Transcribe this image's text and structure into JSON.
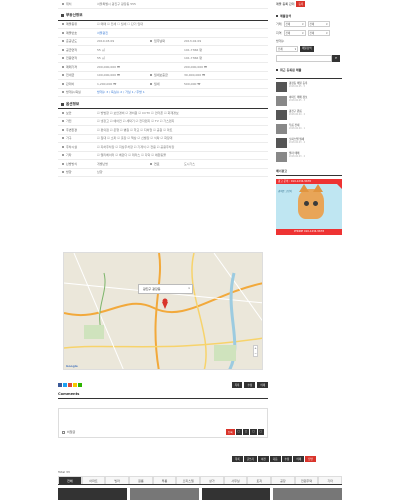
{
  "main": {
    "top_row": {
      "label": "위치",
      "value": "서울특별시 광진구 광장동 555"
    },
    "basic_section": {
      "title": "부동산정보",
      "rows": [
        {
          "label": "매물종류",
          "value": "☑ 매매 ☑ 전세 ☐ 월세 ☐ 단기 임대"
        },
        {
          "label": "매물번호",
          "value": "서울광진"
        },
        {
          "label": "준공년도",
          "value": "2010.03.09",
          "label2": "입주날짜",
          "value2": "2013.02.09"
        },
        {
          "label": "공급면적",
          "value": "55 ㎡",
          "label2": "",
          "value2": "191.7366 평"
        },
        {
          "label": "전용면적",
          "value": "55 ㎡",
          "label2": "",
          "value2": "191.7366 평"
        },
        {
          "label": "매매가격",
          "value": "200,000,000 ₩",
          "label2": "",
          "value2": "200,000,000 ₩"
        },
        {
          "label": "전세금",
          "value": "100,000,000 ₩",
          "label2": "월세보증금",
          "value2": "30,000,000 ₩"
        },
        {
          "label": "관리비",
          "value": "1,200,000 ₩",
          "label2": "월세",
          "value2": "500,000 ₩"
        },
        {
          "label": "방개수/욕실",
          "value": "방개수 3 / 욕실수 2 / 거실 1 / 주방 1"
        }
      ]
    },
    "option_section": {
      "title": "옵션정보",
      "rows": [
        {
          "label": "보안",
          "value": "☑ 방범창 ☑ 보안경비 ☑ 경비원 ☑ CCTV ☑ 인터폰 ☑ 화재경보"
        },
        {
          "label": "가전",
          "value": "☑ 냉장고 ☑ 에어컨 ☑ 세탁기 ☑ 전자렌지 ☑ TV ☑ 가스렌지"
        },
        {
          "label": "주변환경",
          "value": "☑ 편의점 ☑ 은행 ☑ 병원 ☑ 학교 ☑ 지하철 ☑ 공원 ☑ 마트"
        },
        {
          "label": "가구",
          "value": "☑ 침대 ☑ 소파 ☑ 옷장 ☑ 책상 ☑ 신발장 ☑ 식탁 ☑ 화장대"
        },
        {
          "label": "주차시설",
          "value": "☑ 지하주차장 ☑ 지상주차장 ☑ 기계식 ☑ 전용 ☑ 공용주차장"
        },
        {
          "label": "기타",
          "value": "☑ 엘리베이터 ☑ 베란다 ☑ 테라스 ☑ 다락 ☑ 애완동물"
        },
        {
          "label": "난방방식",
          "value": "개별난방",
          "label2": "연료",
          "value2": "도시가스"
        },
        {
          "label": "방향",
          "value": "남향"
        }
      ]
    },
    "map": {
      "popup": "광진구 광장동",
      "close": "x",
      "zoom_plus": "+",
      "zoom_minus": "−",
      "google": "Google"
    },
    "actions": {
      "list": "목록",
      "modify": "수정",
      "delete": "삭제"
    },
    "comments": {
      "title": "Comments",
      "secret_label": "비밀글",
      "submit": "등록",
      "tools": [
        "□",
        "□",
        "□",
        "□"
      ]
    },
    "bottom_bar": [
      "목록",
      "글쓰기",
      "이전",
      "다음",
      "수정",
      "삭제",
      "답변"
    ],
    "total": "Total 33",
    "tabs": [
      "전체",
      "아파트",
      "빌라",
      "원룸",
      "투룸",
      "오피스텔",
      "상가",
      "사무실",
      "토지",
      "공장",
      "전원주택",
      "기타"
    ]
  },
  "sidebar": {
    "top_label": "매물 등록 관리",
    "top_btn": "등록",
    "search_title": "매물검색",
    "deal_label": "거래",
    "deal_options": [
      "전체",
      "전체"
    ],
    "region_label": "지역",
    "region_options": [
      "전체",
      "전체"
    ],
    "room_label": "방개수",
    "room_value": "전체",
    "search_btn": "매물검색",
    "recent_title": "최근 등록된 매물",
    "items": [
      {
        "title": "광장동 매물 등록",
        "meta": "2018.06.05 · 5"
      },
      {
        "title": "아파트 매매 정보",
        "meta": "2018.06.05 · 3"
      },
      {
        "title": "광진구 원룸",
        "meta": "2018.06.04 · 2"
      },
      {
        "title": "투룸 전세",
        "meta": "2018.06.04 · 1"
      },
      {
        "title": "오피스텔 월세",
        "meta": "2018.06.03 · 4"
      },
      {
        "title": "빌라 매매",
        "meta": "2018.06.03 · 2"
      }
    ],
    "banner_title": "배너광고",
    "banner_top": "광고 문의 : 010-1234-5678",
    "banner_side": "귀여운 고양이",
    "banner_foot": "PHONE 010-1234-5678"
  }
}
